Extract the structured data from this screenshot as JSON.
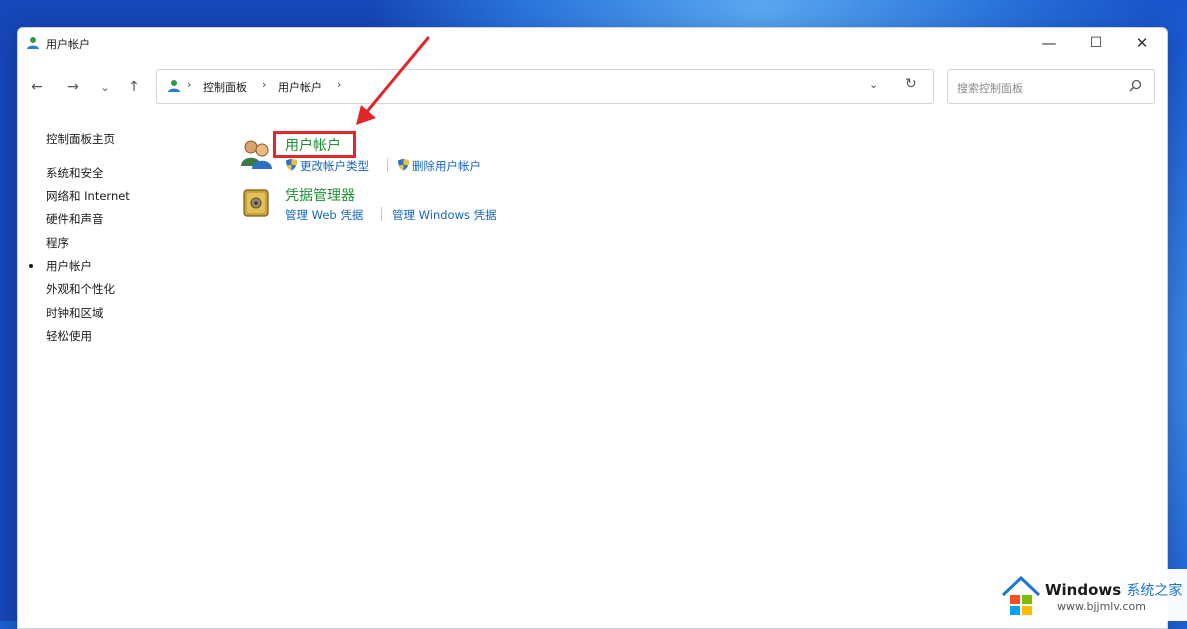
{
  "window": {
    "title": "用户帐户"
  },
  "title_buttons": {
    "minimize": "—",
    "maximize": "☐",
    "close": "✕"
  },
  "nav": {
    "back": "←",
    "forward": "→",
    "recent": "⌄",
    "up": "↑"
  },
  "breadcrumb": {
    "items": [
      "控制面板",
      "用户帐户"
    ],
    "separator": "›"
  },
  "address_controls": {
    "dropdown": "⌄",
    "refresh": "↻"
  },
  "search": {
    "placeholder": "搜索控制面板"
  },
  "sidebar": {
    "home": "控制面板主页",
    "items": [
      {
        "label": "系统和安全"
      },
      {
        "label": "网络和 Internet"
      },
      {
        "label": "硬件和声音"
      },
      {
        "label": "程序"
      },
      {
        "label": "用户帐户",
        "current": true
      },
      {
        "label": "外观和个性化"
      },
      {
        "label": "时钟和区域"
      },
      {
        "label": "轻松使用"
      }
    ]
  },
  "categories": [
    {
      "title": "用户帐户",
      "icon": "users-icon",
      "links": [
        "更改帐户类型",
        "删除用户帐户"
      ]
    },
    {
      "title": "凭据管理器",
      "icon": "safe-icon",
      "links": [
        "管理 Web 凭据",
        "管理 Windows 凭据"
      ]
    }
  ],
  "watermark": {
    "brand": "Windows",
    "brand_cn": "系统之家",
    "url": "www.bjjmlv.com"
  },
  "colors": {
    "accent_green": "#1e8f34",
    "link_blue": "#1565c0",
    "annotation_red": "#e3262a"
  }
}
